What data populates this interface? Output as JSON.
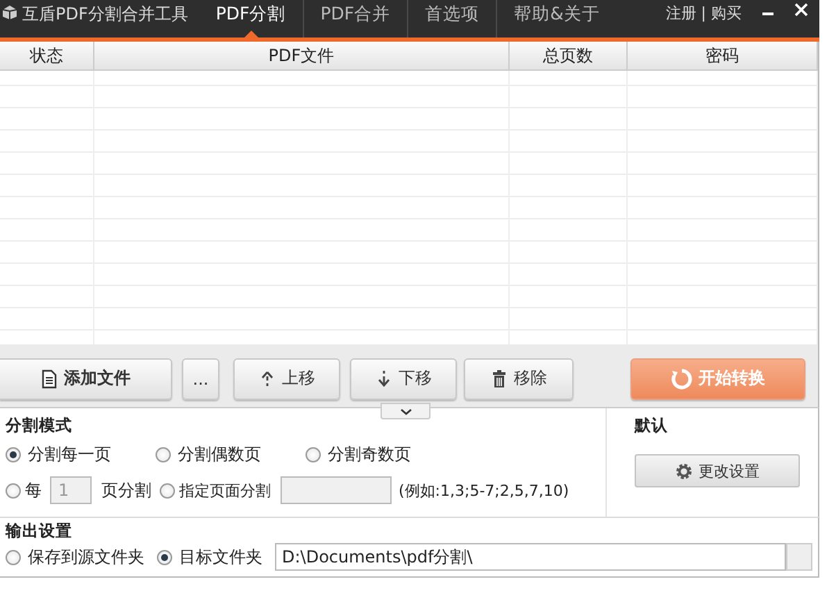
{
  "window": {
    "title": "互盾PDF分割合并工具",
    "account_links": "注册 | 购买"
  },
  "tabs": [
    {
      "label": "PDF分割",
      "selected": true
    },
    {
      "label": "PDF合并",
      "selected": false
    },
    {
      "label": "首选项",
      "selected": false
    },
    {
      "label": "帮助&关于",
      "selected": false
    }
  ],
  "table": {
    "columns": [
      "状态",
      "PDF文件",
      "总页数",
      "密码"
    ]
  },
  "toolbar": {
    "buttons": [
      {
        "kind": "add",
        "label": "添加文件"
      },
      {
        "kind": "more",
        "label": "..."
      },
      {
        "kind": "up",
        "label": "上移"
      },
      {
        "kind": "down",
        "label": "下移"
      },
      {
        "kind": "remove",
        "label": "移除"
      }
    ],
    "start_button": "开始转换"
  },
  "split_mode": {
    "title": "分割模式",
    "options": [
      {
        "kind": "plain",
        "label": "分割每一页",
        "selected": true
      },
      {
        "kind": "plain",
        "label": "分割偶数页",
        "selected": false
      },
      {
        "kind": "plain",
        "label": "分割奇数页",
        "selected": false
      },
      {
        "kind": "every_n",
        "label": "每",
        "value": "1",
        "suffix": "页分割",
        "selected": false
      },
      {
        "kind": "custom",
        "label": "指定页面分割",
        "hint": "(例如:1,3;5-7;2,5,7,10)",
        "selected": false
      }
    ]
  },
  "defaults": {
    "title": "默认",
    "button": "更改设置"
  },
  "output": {
    "title": "输出设置",
    "options": [
      {
        "label": "保存到源文件夹",
        "selected": false
      },
      {
        "label": "目标文件夹",
        "selected": true
      }
    ],
    "path": "D:\\Documents\\pdf分割\\"
  }
}
